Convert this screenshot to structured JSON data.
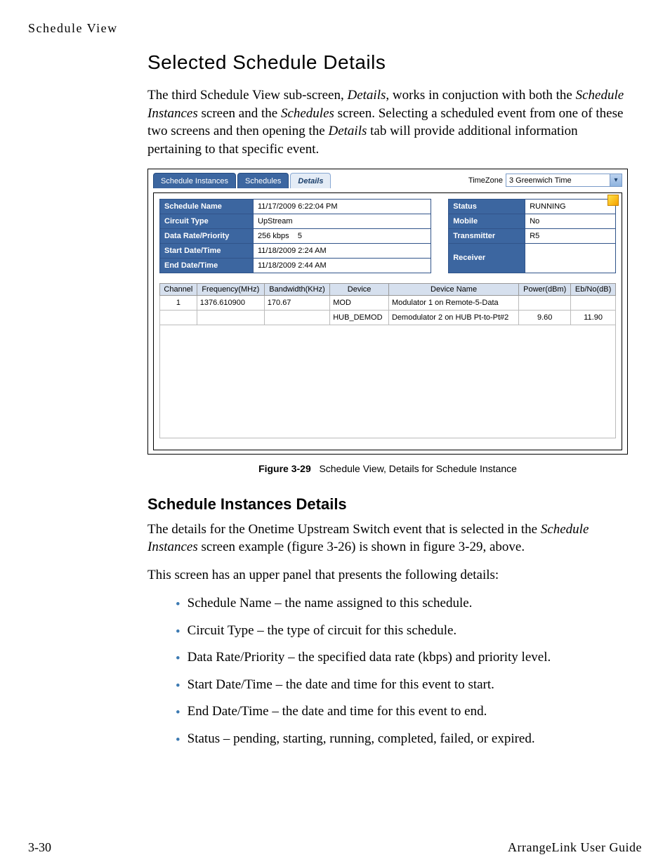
{
  "running_header": "Schedule View",
  "footer": {
    "page": "3-30",
    "doc": "ArrangeLink User Guide"
  },
  "section_title": "Selected Schedule Details",
  "intro_html": "The third Schedule View sub-screen, <i>Details</i>, works in conjuction with both the <i>Schedule Instances</i> screen and the <i>Schedules</i> screen. Selecting a scheduled event from one of these two screens and then opening the <i>Details</i> tab will provide additional information pertaining to that specific event.",
  "tabs": {
    "t1": "Schedule Instances",
    "t2": "Schedules",
    "t3": "Details"
  },
  "timezone": {
    "label": "TimeZone",
    "value": "3 Greenwich Time"
  },
  "props_left": {
    "schedule_name_k": "Schedule Name",
    "schedule_name_v": "11/17/2009 6:22:04 PM",
    "circuit_type_k": "Circuit Type",
    "circuit_type_v": "UpStream",
    "data_rate_k": "Data Rate/Priority",
    "data_rate_v": "256 kbps    5",
    "start_k": "Start Date/Time",
    "start_v": "11/18/2009 2:24 AM",
    "end_k": "End Date/Time",
    "end_v": "11/18/2009 2:44 AM"
  },
  "props_right": {
    "status_k": "Status",
    "status_v": "RUNNING",
    "mobile_k": "Mobile",
    "mobile_v": "No",
    "tx_k": "Transmitter",
    "tx_v": "R5",
    "rx_k": "Receiver",
    "rx_v": ""
  },
  "cols": {
    "c1": "Channel",
    "c2": "Frequency(MHz)",
    "c3": "Bandwidth(KHz)",
    "c4": "Device",
    "c5": "Device Name",
    "c6": "Power(dBm)",
    "c7": "Eb/No(dB)"
  },
  "rows": [
    {
      "ch": "1",
      "freq": "1376.610900",
      "bw": "170.67",
      "dev": "MOD",
      "dname": "Modulator 1 on Remote-5-Data",
      "pw": "",
      "ebno": ""
    },
    {
      "ch": "",
      "freq": "",
      "bw": "",
      "dev": "HUB_DEMOD",
      "dname": "Demodulator 2 on HUB Pt-to-Pt#2",
      "pw": "9.60",
      "ebno": "11.90"
    }
  ],
  "figure": {
    "lead": "Figure 3-29",
    "rest": "Schedule View, Details for Schedule Instance"
  },
  "sub_title": "Schedule Instances Details",
  "para1_html": "The details for the Onetime Upstream Switch event that is selected in the <i>Schedule Instances</i> screen example (figure 3-26) is shown in figure 3-29, above.",
  "para2": "This screen has an upper panel that presents the following details:",
  "bullets": [
    "Schedule Name – the name assigned to this schedule.",
    "Circuit Type – the type of circuit for this schedule.",
    "Data Rate/Priority – the specified data rate (kbps) and priority level.",
    "Start Date/Time – the date and time for this event to start.",
    "End Date/Time – the date and time for this event to end.",
    "Status – pending, starting, running, completed, failed, or expired."
  ]
}
